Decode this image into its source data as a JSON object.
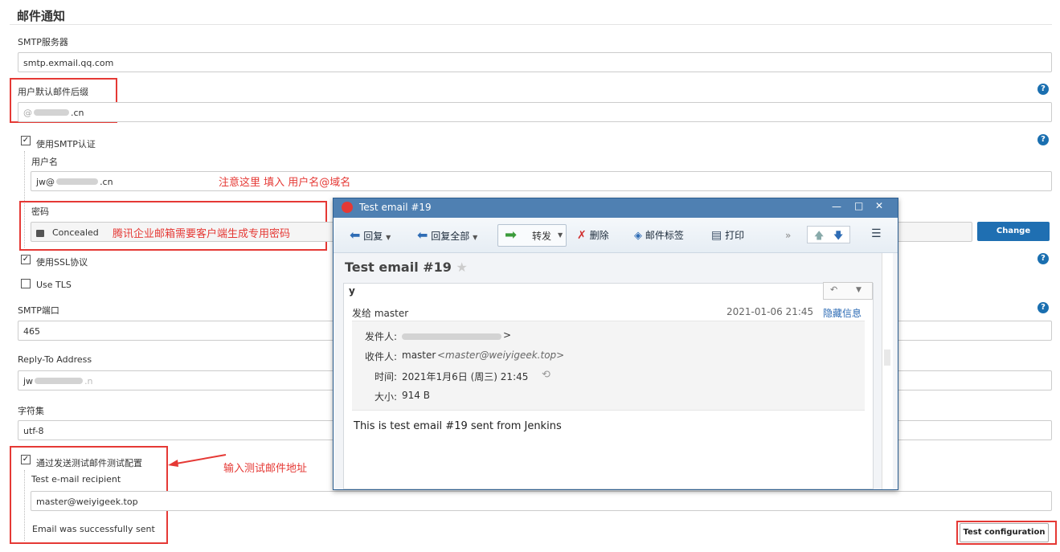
{
  "section_title": "邮件通知",
  "smtp_server": {
    "label": "SMTP服务器",
    "value": "smtp.exmail.qq.com"
  },
  "default_suffix": {
    "label": "用户默认邮件后缀",
    "value_prefix": "@",
    "value_suffix": ".cn"
  },
  "use_smtp_auth": {
    "label": "使用SMTP认证",
    "checked": "✓"
  },
  "username": {
    "label": "用户名",
    "value_prefix": "jw@",
    "value_suffix": ".cn"
  },
  "password": {
    "label": "密码",
    "value": "Concealed",
    "change_button": "Change Password"
  },
  "use_ssl": {
    "label": "使用SSL协议",
    "checked": "✓"
  },
  "use_tls": {
    "label": "Use TLS"
  },
  "smtp_port": {
    "label": "SMTP端口",
    "value": "465"
  },
  "reply_to": {
    "label": "Reply-To Address",
    "value_prefix": "jw",
    "value_suffix": ".n"
  },
  "charset": {
    "label": "字符集",
    "value": "utf-8"
  },
  "test_config": {
    "label": "通过发送测试邮件测试配置",
    "checked": "✓",
    "recipient_label": "Test e-mail recipient",
    "recipient_value": "master@weiyigeek.top",
    "status": "Email was successfully sent",
    "button": "Test configuration"
  },
  "help_glyph": "?",
  "annotations": {
    "username_note": "注意这里 填入 用户名@域名",
    "password_note": "腾讯企业邮箱需要客户端生成专用密码",
    "recipient_note": "输入测试邮件地址"
  },
  "email_window": {
    "title": "Test email #19",
    "controls": {
      "minimize": "—",
      "maximize": "□",
      "close": "✕"
    },
    "toolbar": {
      "reply": "回复",
      "reply_all": "回复全部",
      "forward": "转发",
      "delete": "删除",
      "tag": "邮件标签",
      "print": "打印",
      "more": "»"
    },
    "subject": "Test email #19",
    "sender_initial": "y",
    "to_line": "发给 master",
    "datetime": "2021-01-06 21:45",
    "hide_details": "隐藏信息",
    "from_label": "发件人:",
    "to_label": "收件人:",
    "to_name": "master",
    "to_address": "<master@weiyigeek.top>",
    "time_label": "时间:",
    "time_value": "2021年1月6日 (周三) 21:45",
    "size_label": "大小:",
    "size_value": "914 B",
    "body": "This is test email #19 sent from Jenkins"
  },
  "colors": {
    "accent": "#1f6fb2",
    "annotation": "#e53935",
    "titlebar": "#4f80b2"
  }
}
